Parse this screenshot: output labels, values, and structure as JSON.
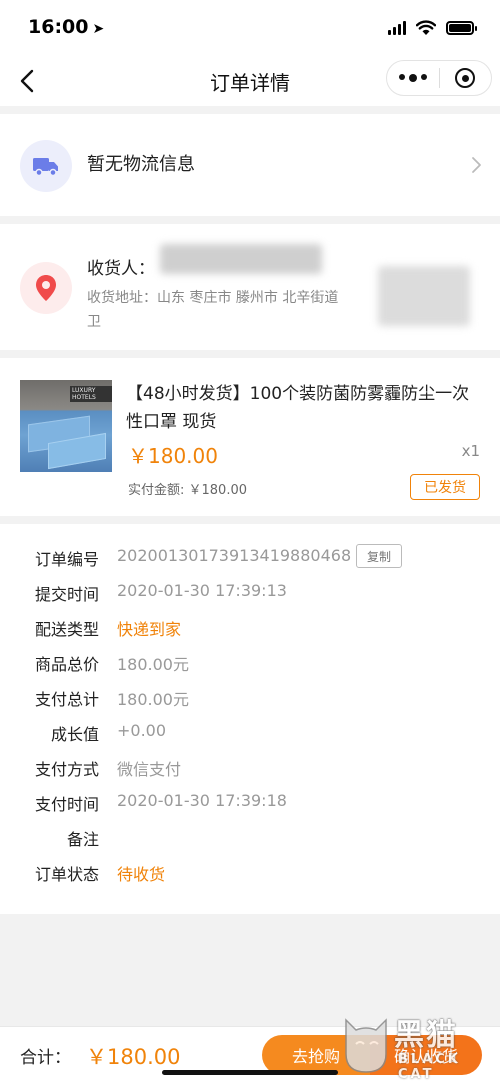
{
  "status_bar": {
    "time": "16:00",
    "location_arrow": "➤"
  },
  "nav": {
    "title": "订单详情"
  },
  "logistics": {
    "text": "暂无物流信息"
  },
  "address": {
    "receiver_label": "收货人：",
    "address_label": "收货地址：",
    "address_text": "山东  枣庄市  滕州市  北辛街道",
    "address_tail": "卫"
  },
  "product": {
    "title": "【48小时发货】100个装防菌防雾霾防尘一次性口罩 现货",
    "image_tag": "LUXURY HOTELS",
    "price": "￥180.00",
    "quantity": "x1",
    "paid_label": "实付金额: ￥180.00",
    "status": "已发货"
  },
  "order_info": {
    "copy_label": "复制",
    "rows": [
      {
        "label": "订单编号",
        "value": "2020013017391341988 0468",
        "value_clean": "20200130173913419880468",
        "style": "gray"
      },
      {
        "label": "提交时间",
        "value": "2020-01-30 17:39:13",
        "style": "gray"
      },
      {
        "label": "配送类型",
        "value": "快递到家",
        "style": "orange"
      },
      {
        "label": "商品总价",
        "value": "180.00元",
        "style": "gray"
      },
      {
        "label": "支付总计",
        "value": "180.00元",
        "style": "gray"
      },
      {
        "label": "成长值",
        "value": "+0.00",
        "style": "gray"
      },
      {
        "label": "支付方式",
        "value": "微信支付",
        "style": "gray"
      },
      {
        "label": "支付时间",
        "value": "2020-01-30 17:39:18",
        "style": "gray"
      },
      {
        "label": "备注",
        "value": "",
        "style": "gray"
      },
      {
        "label": "订单状态",
        "value": "待收货",
        "style": "orange"
      }
    ]
  },
  "bottom": {
    "total_label": "合计：",
    "total_value": "￥180.00",
    "buy_label": "去抢购",
    "confirm_label": "确认收货"
  },
  "watermark": {
    "brand": "黑猫",
    "sub": "BLACK CAT"
  },
  "colors": {
    "accent": "#f0830a",
    "button": "#f58a1f",
    "truck_icon": "#6b7de8",
    "pin_icon": "#f04b4b"
  },
  "icons": {
    "back": "back-arrow-icon",
    "more": "more-dots-icon",
    "target": "target-icon",
    "truck": "truck-icon",
    "location": "location-pin-icon",
    "chevron": "chevron-right-icon"
  }
}
